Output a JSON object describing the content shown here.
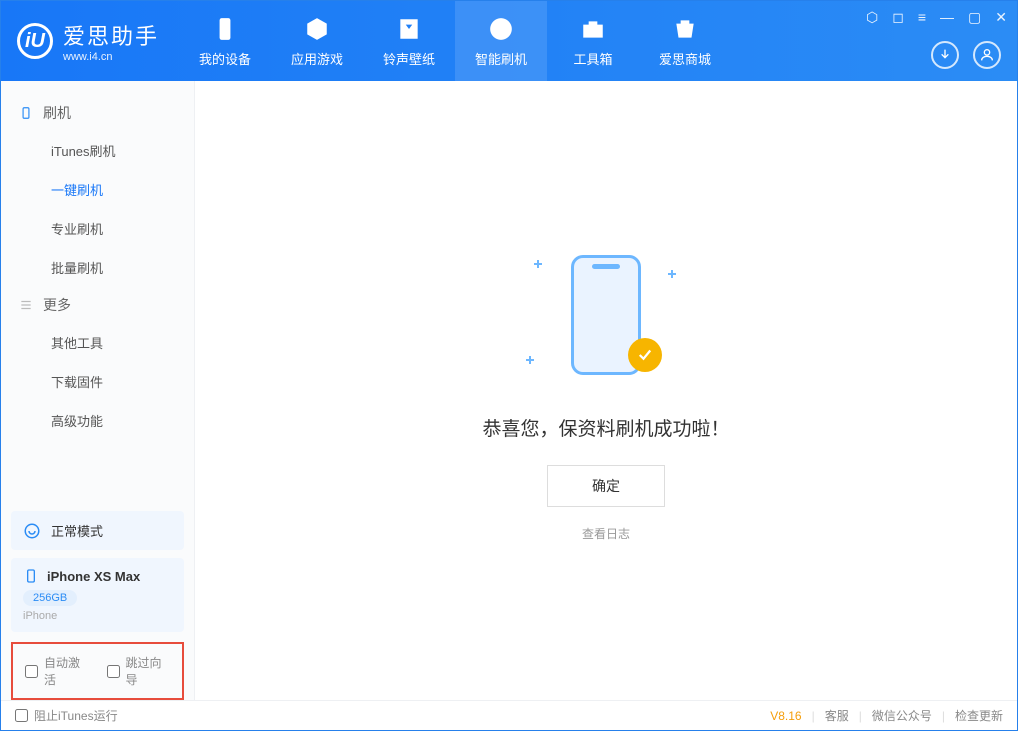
{
  "app": {
    "title": "爱思助手",
    "url": "www.i4.cn"
  },
  "nav": {
    "items": [
      {
        "label": "我的设备"
      },
      {
        "label": "应用游戏"
      },
      {
        "label": "铃声壁纸"
      },
      {
        "label": "智能刷机"
      },
      {
        "label": "工具箱"
      },
      {
        "label": "爱思商城"
      }
    ]
  },
  "sidebar": {
    "section1": {
      "title": "刷机",
      "items": [
        "iTunes刷机",
        "一键刷机",
        "专业刷机",
        "批量刷机"
      ]
    },
    "section2": {
      "title": "更多",
      "items": [
        "其他工具",
        "下载固件",
        "高级功能"
      ]
    }
  },
  "status": {
    "mode": "正常模式"
  },
  "device": {
    "name": "iPhone XS Max",
    "storage": "256GB",
    "type": "iPhone"
  },
  "checks": {
    "auto_activate": "自动激活",
    "skip_guide": "跳过向导"
  },
  "main": {
    "success_msg": "恭喜您，保资料刷机成功啦！",
    "ok": "确定",
    "view_log": "查看日志"
  },
  "footer": {
    "block_itunes": "阻止iTunes运行",
    "version": "V8.16",
    "links": [
      "客服",
      "微信公众号",
      "检查更新"
    ]
  }
}
